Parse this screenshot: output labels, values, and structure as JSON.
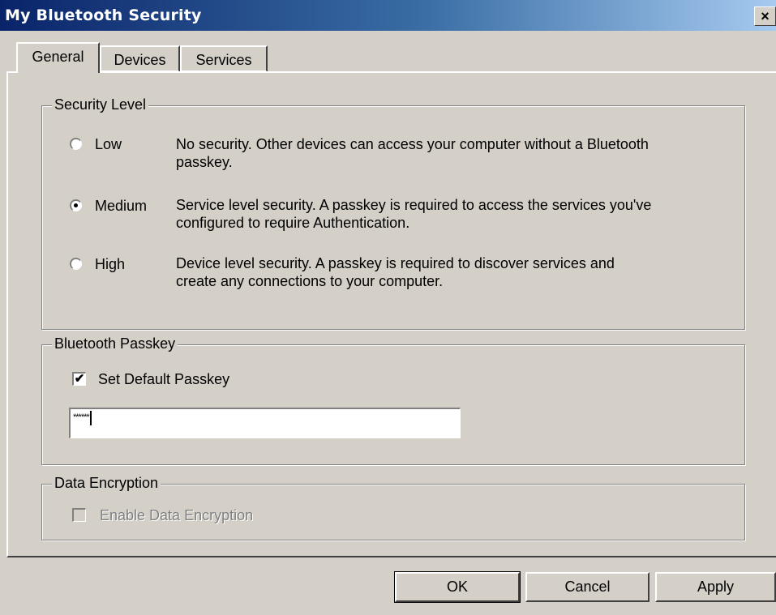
{
  "window": {
    "title": "My Bluetooth Security",
    "close_glyph": "×"
  },
  "tabs": [
    "General",
    "Devices",
    "Services"
  ],
  "security_level": {
    "legend": "Security Level",
    "options": [
      {
        "label": "Low",
        "selected": false,
        "line1": "No security. Other devices can access your computer without a Bluetooth",
        "line2": "passkey."
      },
      {
        "label": "Medium",
        "selected": true,
        "line1": "Service level security. A passkey is required to access the services you've",
        "line2": "configured to require Authentication."
      },
      {
        "label": "High",
        "selected": false,
        "line1": "Device level security. A passkey is required to discover services and",
        "line2": "create any connections to your computer."
      }
    ]
  },
  "passkey": {
    "legend": "Bluetooth Passkey",
    "checkbox_label": "Set Default Passkey",
    "checkbox_checked": true,
    "check_glyph": "✔",
    "value": "******"
  },
  "encryption": {
    "legend": "Data Encryption",
    "checkbox_label": "Enable Data Encryption",
    "checkbox_checked": false,
    "enabled": false
  },
  "buttons": {
    "ok": "OK",
    "cancel": "Cancel",
    "apply": "Apply"
  }
}
